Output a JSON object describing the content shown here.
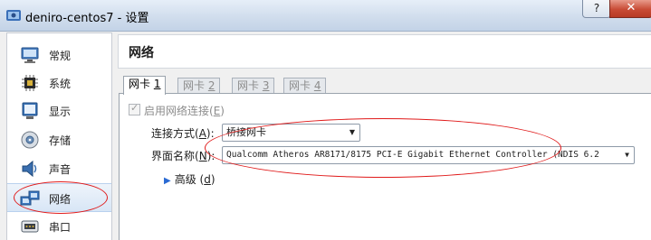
{
  "window": {
    "title": "deniro-centos7 - 设置",
    "help_label": "?",
    "close_label": "✕"
  },
  "sidebar": {
    "items": [
      {
        "label": "常规",
        "icon": "monitor-icon"
      },
      {
        "label": "系统",
        "icon": "chip-icon"
      },
      {
        "label": "显示",
        "icon": "display-icon"
      },
      {
        "label": "存储",
        "icon": "disk-icon"
      },
      {
        "label": "声音",
        "icon": "speaker-icon"
      },
      {
        "label": "网络",
        "icon": "network-icon",
        "selected": true
      },
      {
        "label": "串口",
        "icon": "serial-port-icon"
      }
    ]
  },
  "page": {
    "title": "网络"
  },
  "tabs": [
    {
      "label": "网卡",
      "num": "1",
      "active": true
    },
    {
      "label": "网卡",
      "num": "2"
    },
    {
      "label": "网卡",
      "num": "3"
    },
    {
      "label": "网卡",
      "num": "4"
    }
  ],
  "adapter": {
    "enable_label": "启用网络连接",
    "enable_key": "E",
    "enabled": true,
    "attach_label": "连接方式",
    "attach_key": "A",
    "attach_value": "桥接网卡",
    "name_label": "界面名称",
    "name_key": "N",
    "name_value": "Qualcomm Atheros AR8171/8175 PCI-E Gigabit Ethernet Controller (NDIS 6.2",
    "advanced_label": "高级",
    "advanced_key": "d"
  },
  "colors": {
    "annotation": "#e01a1a",
    "accent": "#2a6ad3"
  }
}
